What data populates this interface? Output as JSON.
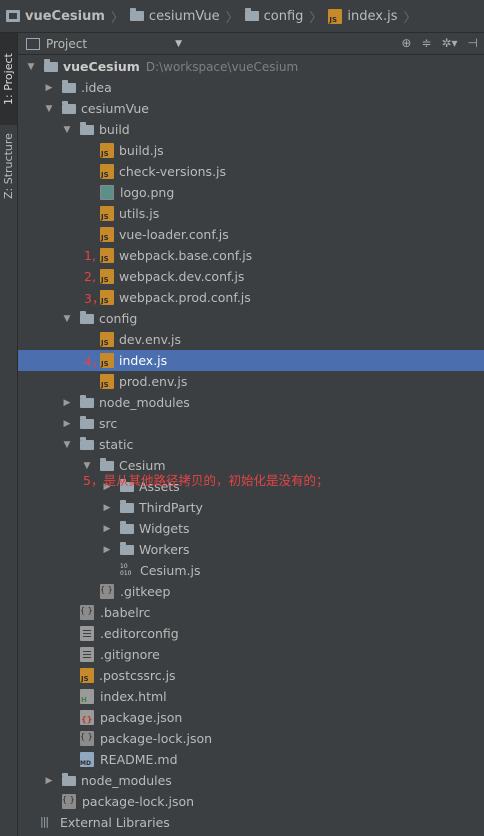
{
  "breadcrumb": {
    "items": [
      {
        "label": "vueCesium",
        "icon": "project-icon"
      },
      {
        "label": "cesiumVue",
        "icon": "folder-icon"
      },
      {
        "label": "config",
        "icon": "folder-icon"
      },
      {
        "label": "index.js",
        "icon": "js-file-icon"
      }
    ]
  },
  "sidebar": {
    "tabs": [
      {
        "label": "1: Project"
      },
      {
        "label": "Z: Structure"
      }
    ]
  },
  "panel": {
    "title": "Project",
    "tools": [
      "crosshair-icon",
      "collapse-icon",
      "gear-icon",
      "hide-icon"
    ]
  },
  "tree": {
    "root": {
      "label": "vueCesium",
      "path": "D:\\workspace\\vueCesium"
    },
    "idea": ".idea",
    "cesiumVue": "cesiumVue",
    "build": "build",
    "build_files": [
      "build.js",
      "check-versions.js",
      "logo.png",
      "utils.js",
      "vue-loader.conf.js",
      "webpack.base.conf.js",
      "webpack.dev.conf.js",
      "webpack.prod.conf.js"
    ],
    "config": "config",
    "config_files": [
      "dev.env.js",
      "index.js",
      "prod.env.js"
    ],
    "node_modules_inner": "node_modules",
    "src": "src",
    "static": "static",
    "cesium": "Cesium",
    "cesium_children": [
      "Assets",
      "ThirdParty",
      "Widgets",
      "Workers"
    ],
    "cesium_js": "Cesium.js",
    "gitkeep": ".gitkeep",
    "root_files": [
      ".babelrc",
      ".editorconfig",
      ".gitignore",
      ".postcssrc.js",
      "index.html",
      "package.json",
      "package-lock.json",
      "README.md"
    ],
    "node_modules_outer": "node_modules",
    "package_lock_outer": "package-lock.json",
    "external_libraries": "External Libraries"
  },
  "annotations": {
    "n1": "1,",
    "n2": "2,",
    "n3": "3，",
    "n4": "4，",
    "n5": "5，是从其他路径拷贝的，初始化是没有的；"
  },
  "colors": {
    "background": "#3c3f41",
    "selection": "#4b6eaf",
    "annotation": "#e34444",
    "js_icon": "#c78a2a"
  }
}
